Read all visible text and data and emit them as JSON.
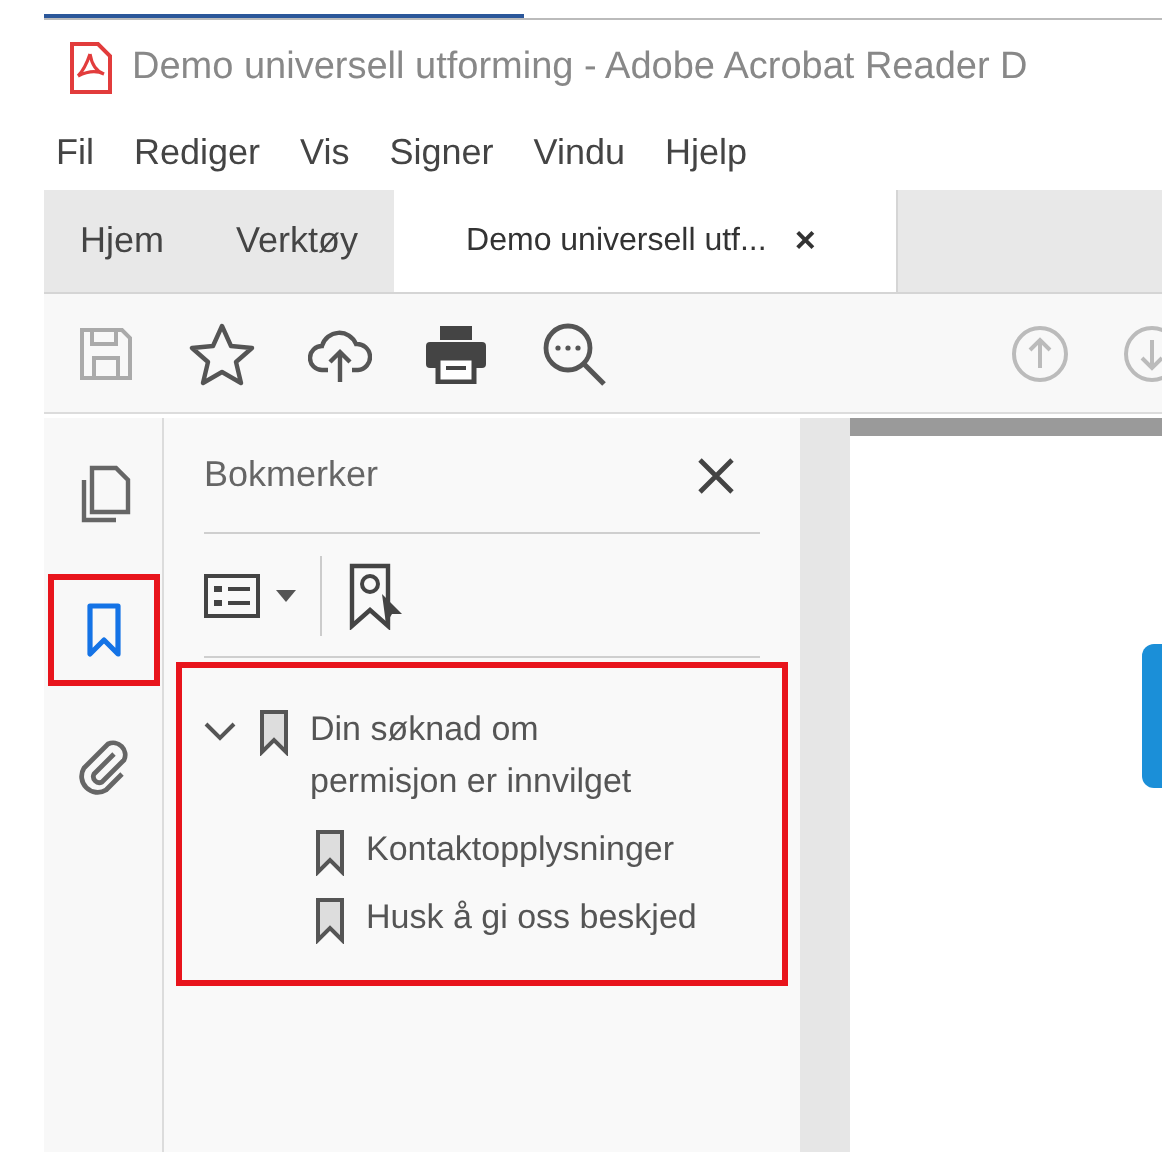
{
  "window": {
    "title": "Demo universell utforming - Adobe Acrobat Reader D"
  },
  "menu": [
    "Fil",
    "Rediger",
    "Vis",
    "Signer",
    "Vindu",
    "Hjelp"
  ],
  "tabs": [
    {
      "label": "Hjem",
      "selected": false
    },
    {
      "label": "Verktøy",
      "selected": false
    },
    {
      "label": "Demo universell utf...",
      "selected": true,
      "close": "×"
    }
  ],
  "side_rail": [
    {
      "kind": "pages",
      "selected": false
    },
    {
      "kind": "bookmarks",
      "selected": true
    },
    {
      "kind": "attachments",
      "selected": false
    }
  ],
  "bookmarks_panel": {
    "title": "Bokmerker",
    "items": [
      {
        "label": "Din søknad om permisjon er innvilget",
        "expanded": true,
        "children": [
          {
            "label": "Kontaktopplysninger"
          },
          {
            "label": "Husk å gi oss beskjed"
          }
        ]
      }
    ]
  }
}
